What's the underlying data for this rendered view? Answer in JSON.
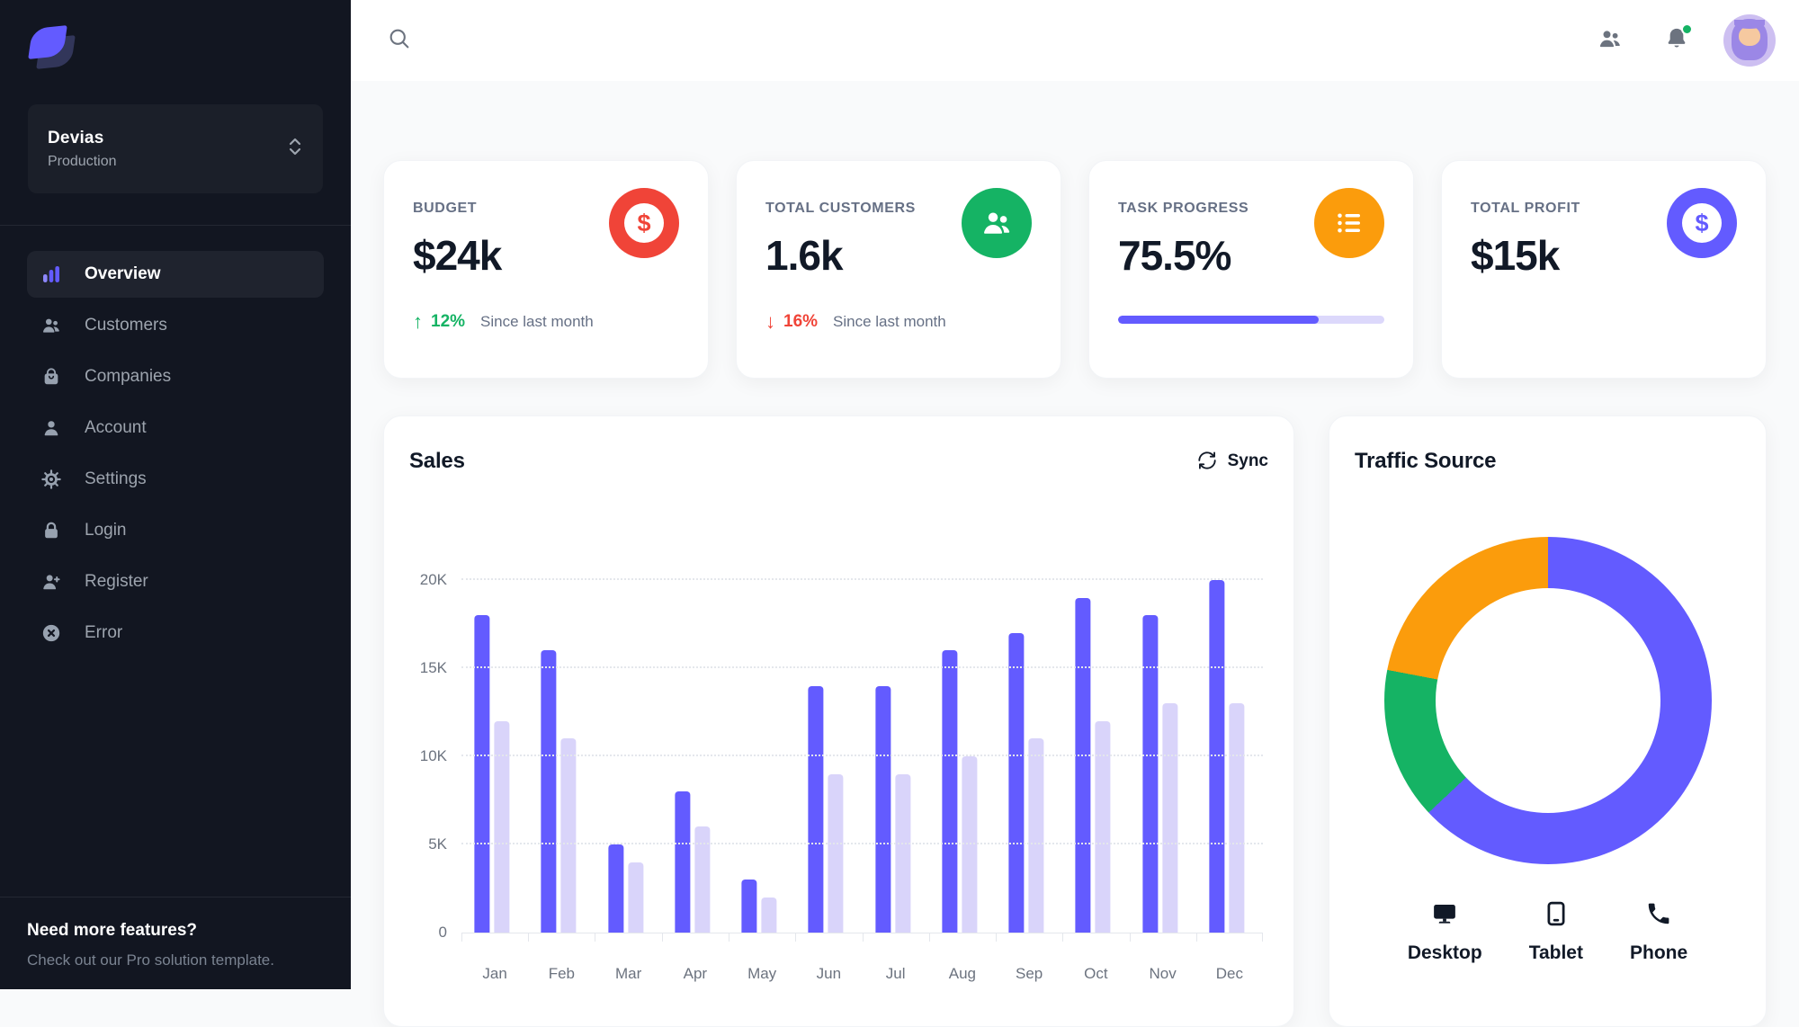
{
  "app": {
    "accent_color": "#635BFF",
    "sidebar_bg": "#121621",
    "page_bg": "#F9FAFB"
  },
  "sidebar": {
    "logo": "devias-leaf-logo",
    "workspace": {
      "name": "Devias",
      "environment": "Production"
    },
    "items": [
      {
        "label": "Overview",
        "icon": "bar-chart-icon",
        "active": true
      },
      {
        "label": "Customers",
        "icon": "users-icon",
        "active": false
      },
      {
        "label": "Companies",
        "icon": "shopping-bag-icon",
        "active": false
      },
      {
        "label": "Account",
        "icon": "user-icon",
        "active": false
      },
      {
        "label": "Settings",
        "icon": "gear-icon",
        "active": false
      },
      {
        "label": "Login",
        "icon": "lock-icon",
        "active": false
      },
      {
        "label": "Register",
        "icon": "user-plus-icon",
        "active": false
      },
      {
        "label": "Error",
        "icon": "x-circle-icon",
        "active": false
      }
    ],
    "footer": {
      "title": "Need more features?",
      "subtitle": "Check out our Pro solution template."
    }
  },
  "header": {
    "icons": [
      "search-icon",
      "contacts-icon",
      "notifications-icon",
      "avatar"
    ],
    "notification_badge": true
  },
  "stats": [
    {
      "label": "BUDGET",
      "value": "$24k",
      "icon": "dollar-icon",
      "icon_bg": "#F04438",
      "trend_arrow": "↑",
      "trend_pct": "12%",
      "trend_color": "#15B364",
      "trend_caption": "Since last month"
    },
    {
      "label": "TOTAL CUSTOMERS",
      "value": "1.6k",
      "icon": "users-icon",
      "icon_bg": "#15B364",
      "trend_arrow": "↓",
      "trend_pct": "16%",
      "trend_color": "#F04438",
      "trend_caption": "Since last month"
    },
    {
      "label": "TASK PROGRESS",
      "value": "75.5%",
      "icon": "list-bullet-icon",
      "icon_bg": "#FB9C0C",
      "progress_pct": 75.5
    },
    {
      "label": "TOTAL PROFIT",
      "value": "$15k",
      "icon": "dollar-icon",
      "icon_bg": "#635BFF"
    }
  ],
  "sales_panel": {
    "title": "Sales",
    "sync_label": "Sync"
  },
  "traffic_panel": {
    "title": "Traffic Source"
  },
  "chart_data": [
    {
      "type": "bar",
      "title": "Sales",
      "categories": [
        "Jan",
        "Feb",
        "Mar",
        "Apr",
        "May",
        "Jun",
        "Jul",
        "Aug",
        "Sep",
        "Oct",
        "Nov",
        "Dec"
      ],
      "series": [
        {
          "name": "primary-dark-bars",
          "color": "#635BFF",
          "values": [
            18000,
            16000,
            5000,
            8000,
            3000,
            14000,
            14000,
            16000,
            17000,
            19000,
            18000,
            20000
          ]
        },
        {
          "name": "secondary-light-bars",
          "color": "#D9D4FA",
          "values": [
            12000,
            11000,
            4000,
            6000,
            2000,
            9000,
            9000,
            10000,
            11000,
            12000,
            13000,
            13000
          ]
        }
      ],
      "ylim": [
        0,
        20000
      ],
      "yticks": [
        {
          "label": "0",
          "value": 0
        },
        {
          "label": "5K",
          "value": 5000
        },
        {
          "label": "10K",
          "value": 10000
        },
        {
          "label": "15K",
          "value": 15000
        },
        {
          "label": "20K",
          "value": 20000
        }
      ],
      "grid": "dotted-horizontal",
      "legend": "none-visible"
    },
    {
      "type": "donut",
      "title": "Traffic Source",
      "segments": [
        {
          "label": "Desktop",
          "value": 63,
          "color": "#635BFF",
          "icon": "desktop-icon"
        },
        {
          "label": "Tablet",
          "value": 15,
          "color": "#15B364",
          "icon": "tablet-icon"
        },
        {
          "label": "Phone",
          "value": 22,
          "color": "#FB9C0C",
          "icon": "phone-icon"
        }
      ],
      "legend_position": "bottom"
    }
  ]
}
